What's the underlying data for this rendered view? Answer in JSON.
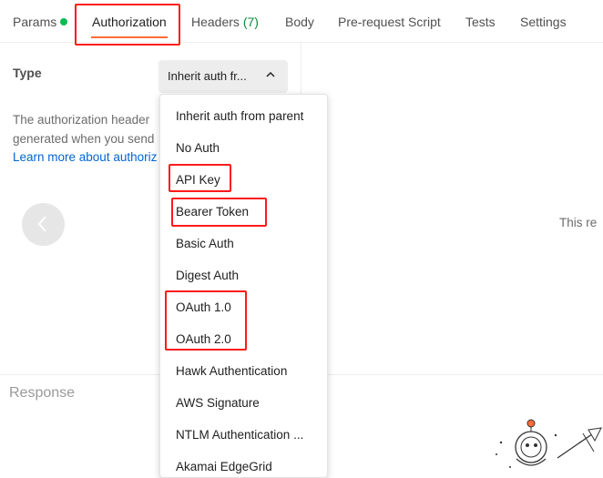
{
  "tabs": [
    {
      "label": "Params"
    },
    {
      "label": "Authorization"
    },
    {
      "label": "Headers",
      "count": "(7)"
    },
    {
      "label": "Body"
    },
    {
      "label": "Pre-request Script"
    },
    {
      "label": "Tests"
    },
    {
      "label": "Settings"
    }
  ],
  "auth": {
    "type_label": "Type",
    "selected": "Inherit auth fr...",
    "description_line1": "The authorization header",
    "description_line2": "generated when you send",
    "learn_more": "Learn more about authoriz"
  },
  "dropdown": {
    "options": [
      "Inherit auth from parent",
      "No Auth",
      "API Key",
      "Bearer Token",
      "Basic Auth",
      "Digest Auth",
      "OAuth 1.0",
      "OAuth 2.0",
      "Hawk Authentication",
      "AWS Signature",
      "NTLM Authentication ...",
      "Akamai EdgeGrid"
    ]
  },
  "right_panel": {
    "text": "This re"
  },
  "response": {
    "title": "Response"
  },
  "colors": {
    "accent": "#ff6c37",
    "annotation": "#ff1a1a",
    "link": "#0265d2",
    "params_dot": "#0cbb52"
  }
}
